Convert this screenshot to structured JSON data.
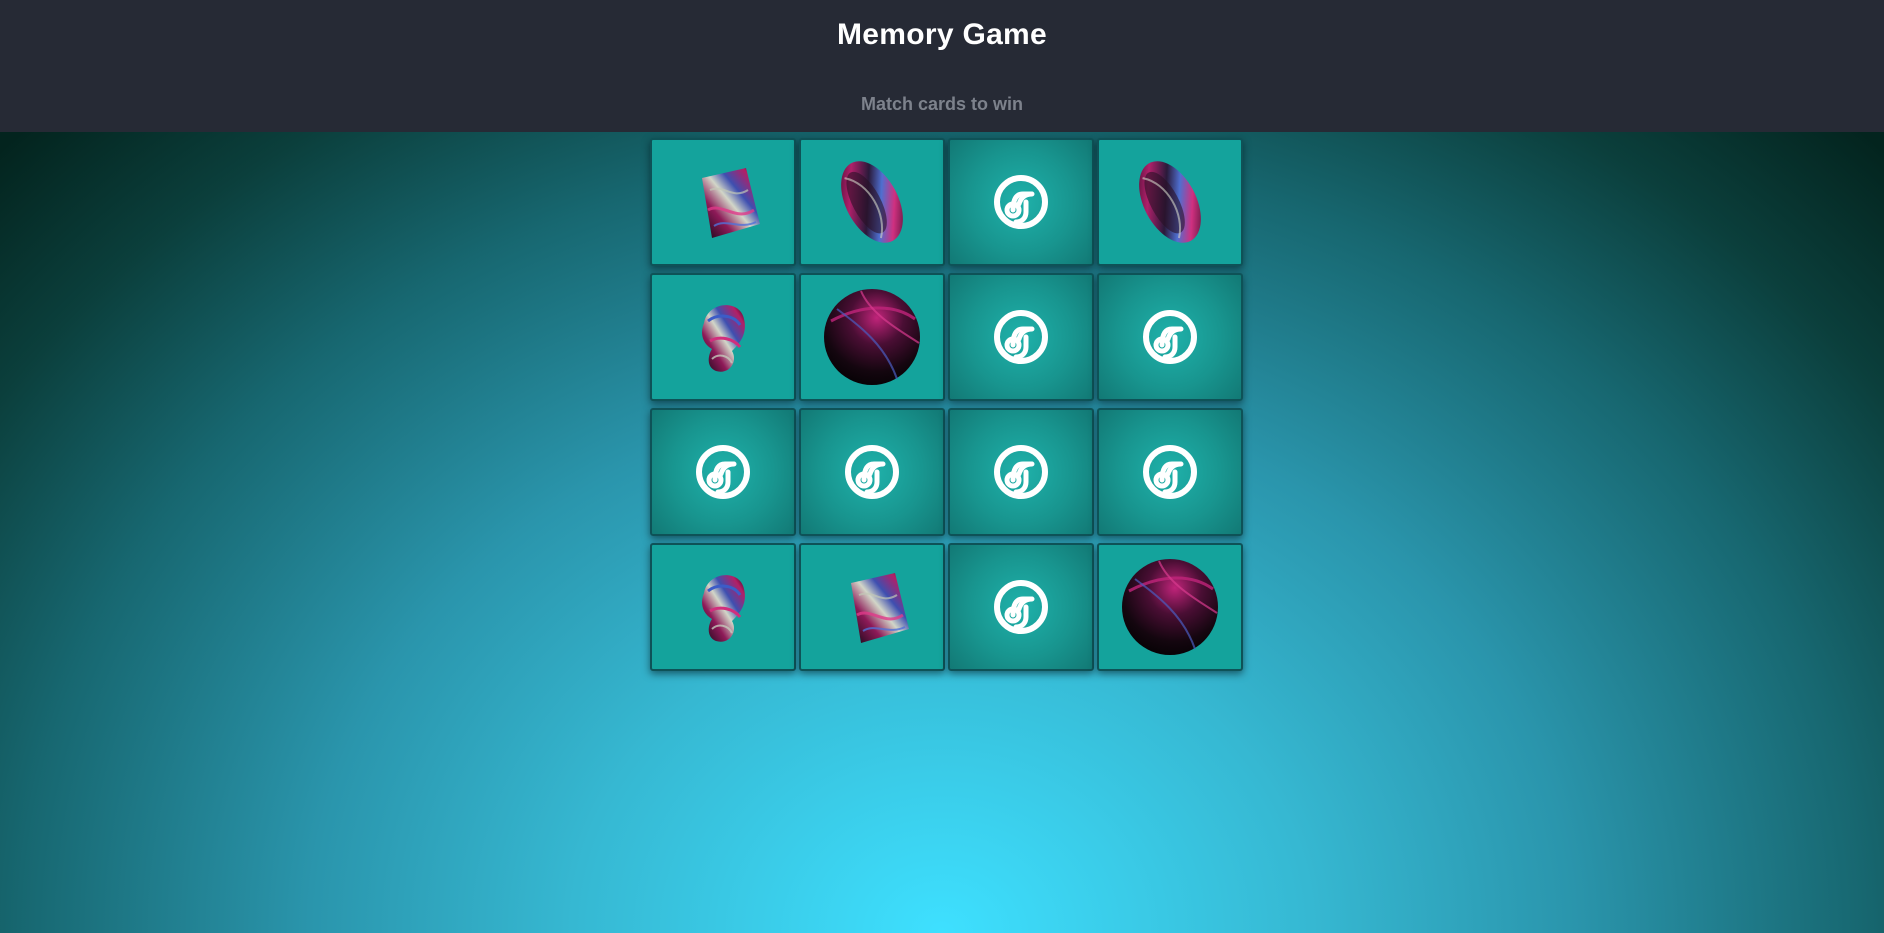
{
  "header": {
    "title": "Memory Game",
    "subtitle": "Match cards to win"
  },
  "board": {
    "rows": 4,
    "columns": 4,
    "cards": [
      {
        "state": "face-up",
        "symbol": "prism-icon"
      },
      {
        "state": "face-up",
        "symbol": "disc-icon"
      },
      {
        "state": "face-down",
        "symbol": "card-back-logo-icon"
      },
      {
        "state": "face-up",
        "symbol": "disc-icon"
      },
      {
        "state": "face-up",
        "symbol": "twisted-knot-icon"
      },
      {
        "state": "face-up",
        "symbol": "sphere-icon"
      },
      {
        "state": "face-down",
        "symbol": "card-back-logo-icon"
      },
      {
        "state": "face-down",
        "symbol": "card-back-logo-icon"
      },
      {
        "state": "face-down",
        "symbol": "card-back-logo-icon"
      },
      {
        "state": "face-down",
        "symbol": "card-back-logo-icon"
      },
      {
        "state": "face-down",
        "symbol": "card-back-logo-icon"
      },
      {
        "state": "face-down",
        "symbol": "card-back-logo-icon"
      },
      {
        "state": "face-up",
        "symbol": "twisted-knot-icon"
      },
      {
        "state": "face-up",
        "symbol": "prism-icon"
      },
      {
        "state": "face-down",
        "symbol": "card-back-logo-icon"
      },
      {
        "state": "face-up",
        "symbol": "sphere-icon"
      }
    ]
  },
  "colors": {
    "header_background": "#262a35",
    "title_text": "#ffffff",
    "subtitle_text": "#7d828c",
    "card_face": "#14a39c",
    "card_back": "#18958f",
    "card_border": "#0e5257"
  }
}
